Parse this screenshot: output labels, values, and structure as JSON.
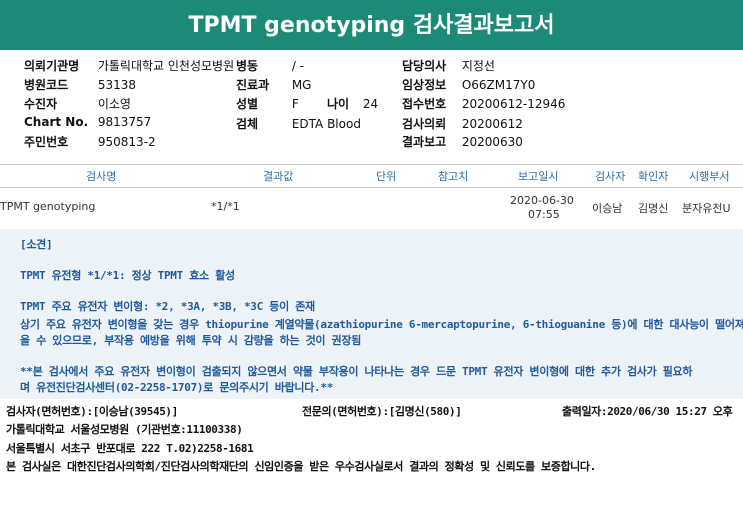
{
  "title": "TPMT genotyping 검사결과보고서",
  "left_info": [
    {
      "label": "의뢰기관명",
      "value": "가톨릭대학교 인천성모병원"
    },
    {
      "label": "병원코드",
      "value": "53138"
    },
    {
      "label": "수진자",
      "value": "이소영"
    },
    {
      "label": "Chart No.",
      "value": "9813757"
    },
    {
      "label": "주민번호",
      "value": "950813-2"
    }
  ],
  "mid_info": [
    {
      "label": "병동",
      "value": "/ -"
    },
    {
      "label": "진료과",
      "value": "MG"
    },
    {
      "label": "성별",
      "value": "F"
    },
    {
      "label": "검체",
      "value": "EDTA Blood"
    }
  ],
  "age": {
    "label": "나이",
    "value": "24"
  },
  "right_info": [
    {
      "label": "담당의사",
      "value": "지정선"
    },
    {
      "label": "임상정보",
      "value": "O66ZM17Y0"
    },
    {
      "label": "접수번호",
      "value": "20200612-12946"
    },
    {
      "label": "검사의뢰",
      "value": "20200612"
    },
    {
      "label": "결과보고",
      "value": "20200630"
    }
  ],
  "table": {
    "headers": [
      "검사명",
      "결과값",
      "단위",
      "참고치",
      "보고일시",
      "검사자",
      "확인자",
      "시행부서"
    ],
    "row": {
      "test": "TPMT genotyping",
      "result": "*1/*1",
      "unit": "",
      "reference": "",
      "report_date": "2020-06-30",
      "report_time": "07:55",
      "tester": "이승남",
      "confirmer": "김명신",
      "department": "분자유전U"
    }
  },
  "comment": {
    "heading": "[소견]",
    "lines": [
      "TPMT 유전형 *1/*1: 정상 TPMT 효소 활성",
      "TPMT 주요 유전자 변이형: *2, *3A, *3B, *3C 등이 존재",
      "상기 주요 유전자 변이형을 갖는 경우 thiopurine 계열약물(azathiopurine 6-mercaptopurine, 6-thioguanine 등)에 대한 대사능이 떨어져 있",
      "을 수 있으므로, 부작용 예방을 위해 투약 시 감량을 하는 것이 권장됨",
      "**본 검사에서 주요 유전자 변이형이 검출되지 않으면서 약물 부작용이 나타나는 경우 드문 TPMT 유전자 변이형에 대한 추가 검사가 필요하",
      "며 유전진단검사센터(02-2258-1707)로 문의주시기 바랍니다.**"
    ]
  },
  "footer": {
    "tester": "검사자(면허번호):[이승남(39545)]",
    "specialist": "전문의(면허번호):[김명신(580)]",
    "printed": "출력일자:2020/06/30 15:27 오후",
    "hospital": "가톨릭대학교 서울성모병원 (기관번호:11100338)",
    "address": "서울특별시 서초구 반포대로 222 T.02)2258-1681",
    "certification": "본 검사실은 대한진단검사의학회/진단검사의학재단의 신임인증을 받은 우수검사실로서 결과의 정확성 및 신뢰도를 보증합니다."
  }
}
